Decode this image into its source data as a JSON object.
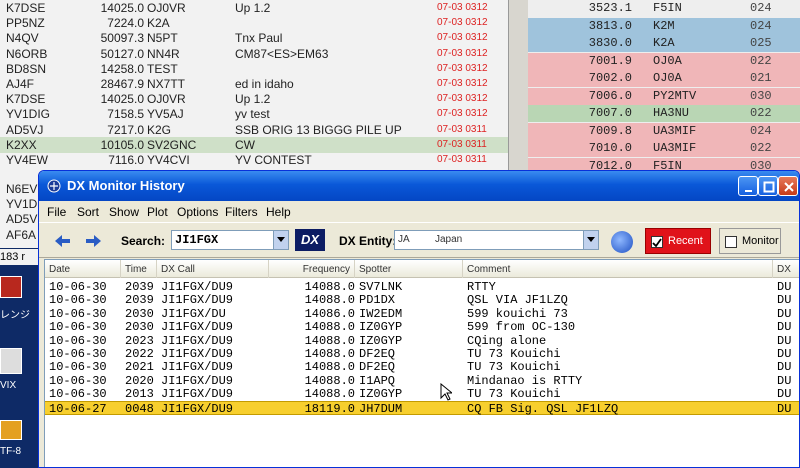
{
  "background_spots": {
    "rows": [
      {
        "call": "K7DSE",
        "freq": "14025.0",
        "spotter": "OJ0VR",
        "comment": "Up 1.2",
        "time": "07-03 0312"
      },
      {
        "call": "PP5NZ",
        "freq": "7224.0",
        "spotter": "K2A",
        "comment": "",
        "time": "07-03 0312"
      },
      {
        "call": "N4QV",
        "freq": "50097.3",
        "spotter": "N5PT",
        "comment": "Tnx Paul",
        "time": "07-03 0312"
      },
      {
        "call": "N6ORB",
        "freq": "50127.0",
        "spotter": "NN4R",
        "comment": "CM87<ES>EM63",
        "time": "07-03 0312"
      },
      {
        "call": "BD8SN",
        "freq": "14258.0",
        "spotter": "TEST",
        "comment": "",
        "time": "07-03 0312"
      },
      {
        "call": "AJ4F",
        "freq": "28467.9",
        "spotter": "NX7TT",
        "comment": "ed in idaho",
        "time": "07-03 0312"
      },
      {
        "call": "K7DSE",
        "freq": "14025.0",
        "spotter": "OJ0VR",
        "comment": "Up 1.2",
        "time": "07-03 0312"
      },
      {
        "call": "YV1DIG",
        "freq": "7158.5",
        "spotter": "YV5AJ",
        "comment": "yv test",
        "time": "07-03 0312"
      },
      {
        "call": "AD5VJ",
        "freq": "7217.0",
        "spotter": "K2G",
        "comment": "SSB ORIG 13 BIGGG PILE UP",
        "time": "07-03 0311"
      },
      {
        "call": "K2XX",
        "freq": "10105.0",
        "spotter": "SV2GNC",
        "comment": "CW",
        "time": "07-03 0311"
      },
      {
        "call": "YV4EW",
        "freq": "7116.0",
        "spotter": "YV4CVI",
        "comment": "YV CONTEST",
        "time": "07-03 0311"
      }
    ],
    "selected_index": 9,
    "partial_calls": [
      "N6EV",
      "YV1D",
      "AD5V",
      "AF6A"
    ],
    "count_label": "183 r"
  },
  "background_bands": {
    "rows": [
      {
        "freq": "3523.1",
        "call": "F5IN",
        "num": "024",
        "color": "#eeeeee"
      },
      {
        "freq": "3813.0",
        "call": "K2M",
        "num": "024",
        "color": "#9fc3dc"
      },
      {
        "freq": "3830.0",
        "call": "K2A",
        "num": "025",
        "color": "#9fc3dc"
      },
      {
        "freq": "7001.9",
        "call": "OJ0A",
        "num": "022",
        "color": "#f0b6b8"
      },
      {
        "freq": "7002.0",
        "call": "OJ0A",
        "num": "021",
        "color": "#f0b6b8"
      },
      {
        "freq": "7006.0",
        "call": "PY2MTV",
        "num": "030",
        "color": "#f0b6b8"
      },
      {
        "freq": "7007.0",
        "call": "HA3NU",
        "num": "022",
        "color": "#b9d6b4"
      },
      {
        "freq": "7009.8",
        "call": "UA3MIF",
        "num": "024",
        "color": "#f0b6b8"
      },
      {
        "freq": "7010.0",
        "call": "UA3MIF",
        "num": "022",
        "color": "#f0b6b8"
      },
      {
        "freq": "7012.0",
        "call": "F5IN",
        "num": "030",
        "color": "#f0b6b8"
      }
    ]
  },
  "desktop": {
    "label_renji": "レンジ",
    "label_vix": "VIX",
    "label_tf": "TF-8"
  },
  "window": {
    "title": "DX Monitor History",
    "menu": [
      "File",
      "Sort",
      "Show",
      "Plot",
      "Options",
      "Filters",
      "Help"
    ],
    "toolbar": {
      "search_label": "Search:",
      "search_value": "JI1FGX",
      "dx_logo": "DX",
      "entity_label": "DX Entity:",
      "entity_prefix": "JA",
      "entity_name": "Japan",
      "recent_label": "Recent",
      "monitor_label": "Monitor"
    },
    "columns": [
      "Date",
      "Time",
      "DX Call",
      "Frequency",
      "Spotter",
      "Comment",
      "DX"
    ],
    "rows": [
      {
        "date": "10-06-30",
        "time": "2039",
        "call": "JI1FGX/DU9",
        "freq": "14088.0",
        "spotter": "SV7LNK",
        "comment": "RTTY",
        "dx": "DU"
      },
      {
        "date": "10-06-30",
        "time": "2039",
        "call": "JI1FGX/DU9",
        "freq": "14088.0",
        "spotter": "PD1DX",
        "comment": "QSL VIA JF1LZQ",
        "dx": "DU"
      },
      {
        "date": "10-06-30",
        "time": "2030",
        "call": "JI1FGX/DU",
        "freq": "14086.0",
        "spotter": "IW2EDM",
        "comment": "599 kouichi 73",
        "dx": "DU"
      },
      {
        "date": "10-06-30",
        "time": "2030",
        "call": "JI1FGX/DU9",
        "freq": "14088.0",
        "spotter": "IZ0GYP",
        "comment": "599 from OC-130",
        "dx": "DU"
      },
      {
        "date": "10-06-30",
        "time": "2023",
        "call": "JI1FGX/DU9",
        "freq": "14088.0",
        "spotter": "IZ0GYP",
        "comment": "CQing alone",
        "dx": "DU"
      },
      {
        "date": "10-06-30",
        "time": "2022",
        "call": "JI1FGX/DU9",
        "freq": "14088.0",
        "spotter": "DF2EQ",
        "comment": "TU 73 Kouichi",
        "dx": "DU"
      },
      {
        "date": "10-06-30",
        "time": "2021",
        "call": "JI1FGX/DU9",
        "freq": "14088.0",
        "spotter": "DF2EQ",
        "comment": "TU 73 Kouichi",
        "dx": "DU"
      },
      {
        "date": "10-06-30",
        "time": "2020",
        "call": "JI1FGX/DU9",
        "freq": "14088.0",
        "spotter": "I1APQ",
        "comment": "Mindanao is RTTY",
        "dx": "DU"
      },
      {
        "date": "10-06-30",
        "time": "2013",
        "call": "JI1FGX/DU9",
        "freq": "14088.0",
        "spotter": "IZ0GYP",
        "comment": "TU 73 Kouichi",
        "dx": "DU"
      },
      {
        "date": "10-06-27",
        "time": "0048",
        "call": "JI1FGX/DU9",
        "freq": "18119.0",
        "spotter": "JH7DUM",
        "comment": "CQ   FB Sig.     QSL JF1LZQ",
        "dx": "DU"
      }
    ],
    "selected_row": 9,
    "colors": {
      "selected": "#f7cf2e",
      "recent_button": "#e0121a",
      "titlebar": "#0a58d8"
    }
  }
}
